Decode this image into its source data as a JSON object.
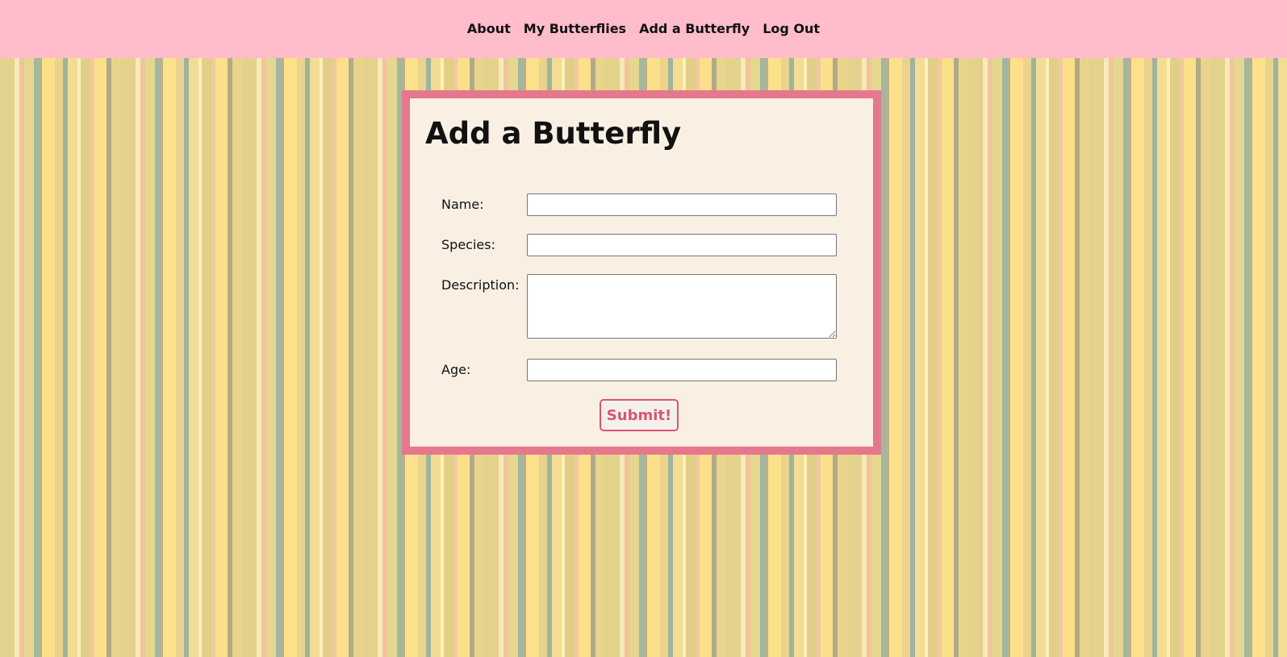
{
  "nav": {
    "items": [
      {
        "label": "About"
      },
      {
        "label": "My Butterflies"
      },
      {
        "label": "Add a Butterfly"
      },
      {
        "label": "Log Out"
      }
    ]
  },
  "form": {
    "title": "Add a Butterfly",
    "fields": {
      "name": {
        "label": "Name:",
        "value": ""
      },
      "species": {
        "label": "Species:",
        "value": ""
      },
      "description": {
        "label": "Description:",
        "value": ""
      },
      "age": {
        "label": "Age:",
        "value": ""
      }
    },
    "submit_label": "Submit!"
  },
  "colors": {
    "nav_background": "#ffbccb",
    "card_border": "#e5788c",
    "card_background": "#f9f0e3",
    "button_accent": "#d9566f"
  }
}
